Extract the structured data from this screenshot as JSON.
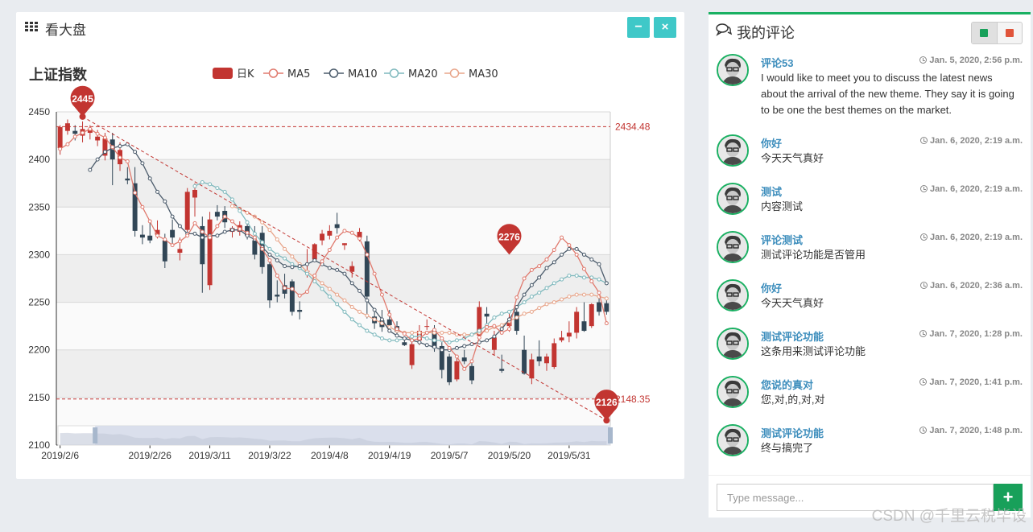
{
  "left_panel": {
    "title": "看大盘",
    "icon": "grid-icon",
    "minimize_label": "−",
    "close_label": "×"
  },
  "chart_data": {
    "type": "candlestick",
    "title": "上证指数",
    "legend": [
      "日K",
      "MA5",
      "MA10",
      "MA20",
      "MA30"
    ],
    "colors": {
      "up": "#c23531",
      "down": "#314656",
      "MA5": "#e07a6e",
      "MA10": "#4b5b6b",
      "MA20": "#7fb9bd",
      "MA30": "#e8a58a"
    },
    "ylim": [
      2100,
      2450
    ],
    "yticks": [
      2100,
      2150,
      2200,
      2250,
      2300,
      2350,
      2400,
      2450
    ],
    "xtick_labels": [
      "2019/2/6",
      "2019/2/26",
      "2019/3/11",
      "2019/3/22",
      "2019/4/8",
      "2019/4/19",
      "2019/5/7",
      "2019/5/20",
      "2019/5/31"
    ],
    "xtick_index": [
      0,
      12,
      20,
      28,
      36,
      44,
      52,
      60,
      68
    ],
    "n": 74,
    "candles": [
      [
        2412,
        2434,
        2405,
        2436
      ],
      [
        2430,
        2438,
        2426,
        2442
      ],
      [
        2430,
        2427,
        2420,
        2436
      ],
      [
        2425,
        2432,
        2418,
        2440
      ],
      [
        2428,
        2432,
        2421,
        2436
      ],
      [
        2420,
        2424,
        2414,
        2431
      ],
      [
        2404,
        2422,
        2399,
        2428
      ],
      [
        2421,
        2400,
        2373,
        2428
      ],
      [
        2395,
        2410,
        2388,
        2418
      ],
      [
        2380,
        2378,
        2374,
        2392
      ],
      [
        2375,
        2325,
        2319,
        2392
      ],
      [
        2321,
        2318,
        2311,
        2331
      ],
      [
        2320,
        2315,
        2312,
        2334
      ],
      [
        2321,
        2326,
        2317,
        2336
      ],
      [
        2315,
        2293,
        2286,
        2322
      ],
      [
        2326,
        2318,
        2308,
        2337
      ],
      [
        2302,
        2306,
        2294,
        2318
      ],
      [
        2326,
        2366,
        2322,
        2370
      ],
      [
        2360,
        2368,
        2340,
        2375
      ],
      [
        2330,
        2290,
        2260,
        2340
      ],
      [
        2268,
        2337,
        2263,
        2345
      ],
      [
        2345,
        2340,
        2336,
        2352
      ],
      [
        2346,
        2334,
        2328,
        2351
      ],
      [
        2324,
        2328,
        2318,
        2330
      ],
      [
        2324,
        2331,
        2320,
        2335
      ],
      [
        2330,
        2320,
        2316,
        2336
      ],
      [
        2315,
        2300,
        2295,
        2330
      ],
      [
        2323,
        2287,
        2280,
        2330
      ],
      [
        2290,
        2252,
        2244,
        2293
      ],
      [
        2258,
        2256,
        2250,
        2273
      ],
      [
        2268,
        2259,
        2254,
        2280
      ],
      [
        2272,
        2240,
        2236,
        2274
      ],
      [
        2242,
        2240,
        2232,
        2251
      ],
      [
        2282,
        2283,
        2276,
        2306
      ],
      [
        2295,
        2311,
        2292,
        2312
      ],
      [
        2315,
        2322,
        2310,
        2326
      ],
      [
        2320,
        2325,
        2316,
        2331
      ],
      [
        2332,
        2328,
        2322,
        2344
      ],
      [
        2310,
        2312,
        2305,
        2312
      ],
      [
        2282,
        2288,
        2276,
        2293
      ],
      [
        2318,
        2324,
        2314,
        2328
      ],
      [
        2314,
        2256,
        2233,
        2320
      ],
      [
        2235,
        2228,
        2222,
        2242
      ],
      [
        2231,
        2224,
        2219,
        2242
      ],
      [
        2232,
        2226,
        2221,
        2242
      ],
      [
        2225,
        2219,
        2216,
        2230
      ],
      [
        2208,
        2205,
        2204,
        2212
      ],
      [
        2184,
        2206,
        2180,
        2215
      ],
      [
        2210,
        2220,
        2205,
        2226
      ],
      [
        2225,
        2225,
        2221,
        2232
      ],
      [
        2220,
        2202,
        2198,
        2226
      ],
      [
        2204,
        2179,
        2170,
        2208
      ],
      [
        2193,
        2166,
        2163,
        2196
      ],
      [
        2169,
        2188,
        2167,
        2193
      ],
      [
        2192,
        2188,
        2185,
        2200
      ],
      [
        2183,
        2168,
        2164,
        2187
      ],
      [
        2215,
        2245,
        2211,
        2251
      ],
      [
        2238,
        2235,
        2227,
        2245
      ],
      [
        2200,
        2213,
        2194,
        2220
      ],
      [
        2180,
        2178,
        2176,
        2195
      ],
      [
        2225,
        2230,
        2219,
        2238
      ],
      [
        2240,
        2220,
        2216,
        2245
      ],
      [
        2200,
        2175,
        2174,
        2215
      ],
      [
        2170,
        2190,
        2164,
        2196
      ],
      [
        2193,
        2188,
        2183,
        2210
      ],
      [
        2186,
        2193,
        2178,
        2196
      ],
      [
        2182,
        2207,
        2180,
        2212
      ],
      [
        2210,
        2213,
        2208,
        2220
      ],
      [
        2214,
        2218,
        2208,
        2230
      ],
      [
        2218,
        2240,
        2212,
        2245
      ],
      [
        2230,
        2220,
        2219,
        2250
      ],
      [
        2225,
        2248,
        2223,
        2249
      ],
      [
        2250,
        2240,
        2236,
        2255
      ],
      [
        2249,
        2240,
        2237,
        2256
      ]
    ],
    "ma5": [
      2411,
      2416,
      2424,
      2428,
      2432,
      2427,
      2423,
      2413,
      2402,
      2398,
      2365,
      2350,
      2335,
      2320,
      2316,
      2310,
      2314,
      2320,
      2333,
      2324,
      2318,
      2330,
      2340,
      2335,
      2327,
      2323,
      2318,
      2306,
      2294,
      2278,
      2265,
      2264,
      2257,
      2261,
      2278,
      2293,
      2305,
      2318,
      2325,
      2323,
      2317,
      2300,
      2280,
      2258,
      2237,
      2222,
      2217,
      2210,
      2212,
      2218,
      2221,
      2212,
      2202,
      2193,
      2180,
      2188,
      2213,
      2224,
      2225,
      2218,
      2222,
      2255,
      2275,
      2284,
      2288,
      2295,
      2305,
      2318,
      2310,
      2300,
      2285,
      2272,
      2260,
      2228
    ],
    "ma10": [
      null,
      null,
      null,
      null,
      2389,
      2400,
      2408,
      2412,
      2414,
      2416,
      2408,
      2396,
      2380,
      2366,
      2356,
      2340,
      2330,
      2322,
      2322,
      2318,
      2320,
      2320,
      2324,
      2326,
      2326,
      2320,
      2316,
      2308,
      2300,
      2294,
      2288,
      2287,
      2288,
      2290,
      2294,
      2290,
      2286,
      2284,
      2280,
      2270,
      2262,
      2252,
      2242,
      2232,
      2220,
      2215,
      2212,
      2210,
      2208,
      2205,
      2203,
      2200,
      2200,
      2202,
      2204,
      2206,
      2208,
      2210,
      2214,
      2222,
      2232,
      2245,
      2258,
      2268,
      2276,
      2286,
      2292,
      2300,
      2306,
      2306,
      2300,
      2295,
      2290,
      2270
    ],
    "ma20": [
      null,
      null,
      null,
      null,
      null,
      null,
      null,
      null,
      null,
      null,
      null,
      null,
      null,
      null,
      null,
      null,
      null,
      null,
      2372,
      2376,
      2374,
      2370,
      2366,
      2358,
      2346,
      2334,
      2322,
      2313,
      2306,
      2300,
      2296,
      2290,
      2286,
      2280,
      2272,
      2264,
      2256,
      2248,
      2240,
      2232,
      2226,
      2220,
      2216,
      2212,
      2210,
      2210,
      2212,
      2214,
      2214,
      2212,
      2210,
      2210,
      2208,
      2210,
      2212,
      2216,
      2220,
      2226,
      2234,
      2238,
      2240,
      2245,
      2250,
      2256,
      2260,
      2265,
      2270,
      2274,
      2278,
      2278,
      2276,
      2276,
      2274,
      2270
    ],
    "ma30": [
      null,
      null,
      null,
      null,
      null,
      null,
      null,
      null,
      null,
      null,
      null,
      null,
      null,
      null,
      null,
      null,
      null,
      null,
      null,
      null,
      null,
      null,
      null,
      2351,
      2348,
      2344,
      2340,
      2334,
      2326,
      2316,
      2306,
      2298,
      2290,
      2282,
      2276,
      2270,
      2264,
      2258,
      2252,
      2245,
      2240,
      2236,
      2232,
      2228,
      2224,
      2220,
      2218,
      2218,
      2218,
      2218,
      2218,
      2218,
      2218,
      2216,
      2216,
      2216,
      2218,
      2220,
      2224,
      2226,
      2230,
      2234,
      2238,
      2240,
      2244,
      2248,
      2250,
      2253,
      2256,
      2258,
      2258,
      2258,
      2256,
      2254
    ],
    "markpoints": [
      {
        "label": "2445",
        "index": 3,
        "value": 2445
      },
      {
        "label": "2276",
        "index": 60,
        "value": 2300
      },
      {
        "label": "2126",
        "index": 73,
        "value": 2126
      }
    ],
    "marklines": [
      {
        "label": "2434.48",
        "value": 2434.48
      },
      {
        "label": "2148.35",
        "value": 2148.35
      }
    ],
    "trendline": [
      [
        3,
        2445
      ],
      [
        73,
        2126
      ]
    ],
    "datazoom": {
      "start_fraction": 0.0,
      "selected_start": 0.07,
      "selected_end": 1.0
    }
  },
  "right_panel": {
    "title": "我的评论",
    "icon": "comments-icon",
    "messages": [
      {
        "name": "评论53",
        "time": "Jan. 5, 2020, 2:56 p.m.",
        "text": "I would like to meet you to discuss the latest news about the arrival of the new theme. They say it is going to be one the best themes on the market."
      },
      {
        "name": "你好",
        "time": "Jan. 6, 2020, 2:19 a.m.",
        "text": "今天天气真好"
      },
      {
        "name": "测试",
        "time": "Jan. 6, 2020, 2:19 a.m.",
        "text": "内容测试"
      },
      {
        "name": "评论测试",
        "time": "Jan. 6, 2020, 2:19 a.m.",
        "text": "测试评论功能是否管用"
      },
      {
        "name": "你好",
        "time": "Jan. 6, 2020, 2:36 a.m.",
        "text": "今天天气真好"
      },
      {
        "name": "测试评论功能",
        "time": "Jan. 7, 2020, 1:28 p.m.",
        "text": "这条用来测试评论功能"
      },
      {
        "name": "您说的真对",
        "time": "Jan. 7, 2020, 1:41 p.m.",
        "text": "您,对,的,对,对"
      },
      {
        "name": "测试评论功能",
        "time": "Jan. 7, 2020, 1:48 p.m.",
        "text": "终与搞完了"
      }
    ],
    "input_placeholder": "Type message...",
    "send_label": "+"
  },
  "watermark": "CSDN @千里云税毕设"
}
